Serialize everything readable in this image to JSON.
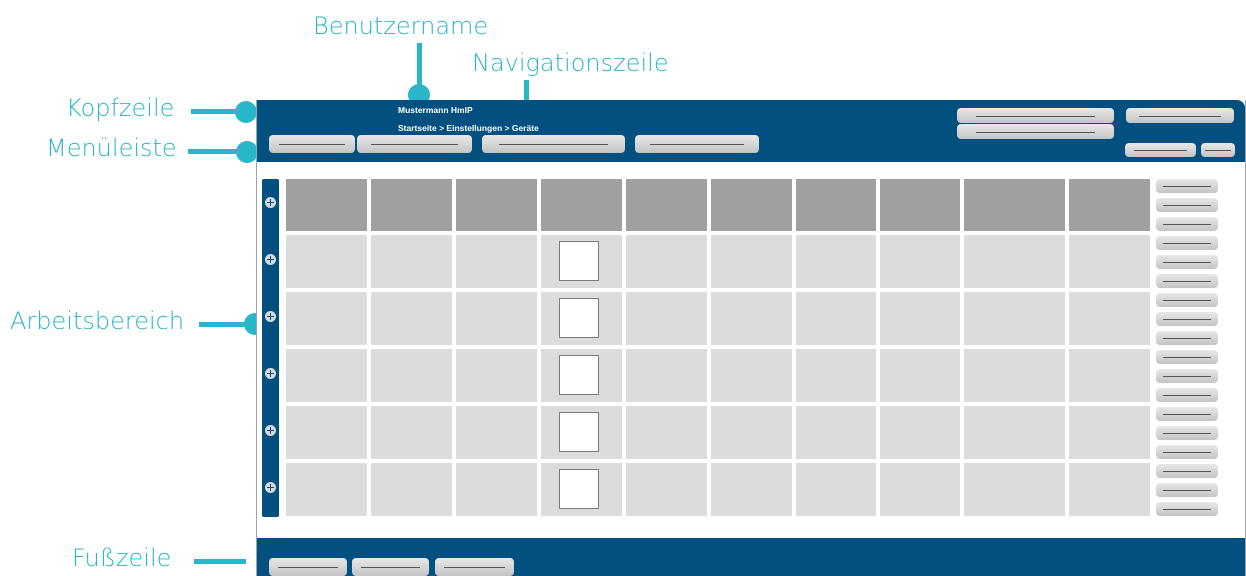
{
  "annotations": {
    "benutzername": "Benutzername",
    "navigationszeile": "Navigationszeile",
    "kopfzeile": "Kopfzeile",
    "menueleiste": "Menüleiste",
    "arbeitsbereich": "Arbeitsbereich",
    "fusszeile": "Fußzeile"
  },
  "header": {
    "user_name": "Mustermann HmIP",
    "breadcrumb": "Startseite > Einstellungen > Geräte"
  },
  "colors": {
    "annotation": "#29b6c8",
    "bar": "#02507f",
    "table_header": "#a0a0a0",
    "table_cell": "#dcdcdc"
  },
  "table": {
    "column_count": 10,
    "row_count": 5
  }
}
